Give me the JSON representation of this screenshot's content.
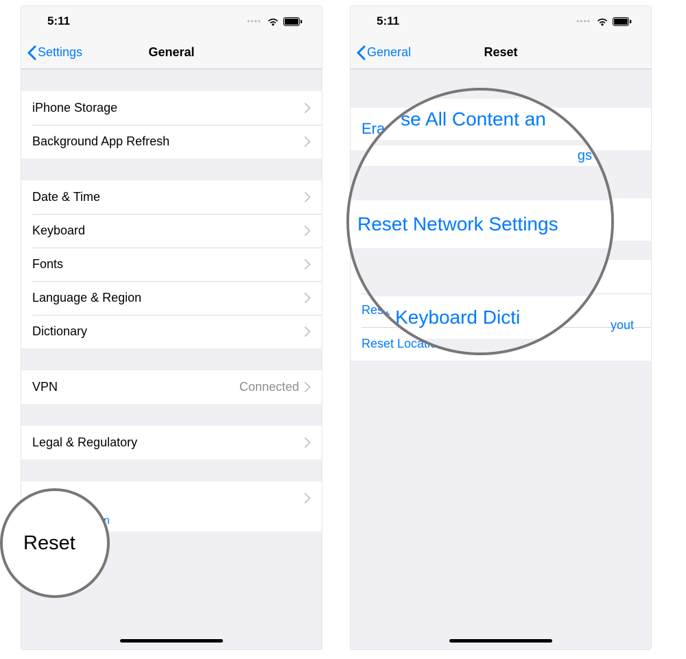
{
  "status": {
    "time": "5:11"
  },
  "left": {
    "back": "Settings",
    "title": "General",
    "rows": {
      "storage": "iPhone Storage",
      "bgrefresh": "Background App Refresh",
      "datetime": "Date & Time",
      "keyboard": "Keyboard",
      "fonts": "Fonts",
      "langregion": "Language & Region",
      "dictionary": "Dictionary",
      "vpn": "VPN",
      "vpn_value": "Connected",
      "legal": "Legal & Regulatory",
      "reset": "Reset"
    },
    "zoom_text": "Reset"
  },
  "right": {
    "back": "General",
    "title": "Reset",
    "rows": {
      "erase_all": "Erase All Content and Settings",
      "reset_network": "Reset Network Settings",
      "reset_keyboard": "Reset Keyboard Dictionary",
      "reset_home": "Reset Home Screen Layout",
      "reset_location": "Reset Location & Privacy"
    },
    "zoom": {
      "line1": "se All Content an",
      "frag": "gs",
      "line2": "Reset Network Settings",
      "line3": "et Keyboard Dicti",
      "layout_tail": "yout"
    }
  }
}
